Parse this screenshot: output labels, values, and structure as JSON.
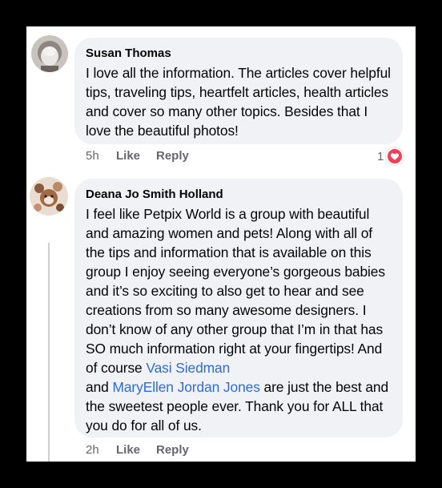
{
  "comments": [
    {
      "author": "Susan Thomas",
      "text": "I love all the information.  The articles cover helpful tips, traveling tips, heartfelt articles, health articles and cover so many other topics. Besides that I love the beautiful photos!",
      "time": "5h",
      "like_label": "Like",
      "reply_label": "Reply",
      "reaction_count": "1",
      "reaction_icon": "heart-icon"
    },
    {
      "author": "Deana Jo Smith Holland",
      "text_before": "I feel like Petpix World is a group with beautiful and amazing women and pets! Along with all of the tips and information that is available on this group I enjoy seeing everyone’s gorgeous babies and it’s so exciting to also get to hear and see creations from so many awesome designers. I don’t know of any other group that I’m in that has SO much information right at your fingertips! And of course ",
      "mention1": "Vasi Siedman",
      "text_between": "\nand ",
      "mention2": "MaryEllen Jordan Jones",
      "text_after": " are just the best and the sweetest people ever. Thank you for ALL that you do for all of us.",
      "time": "2h",
      "like_label": "Like",
      "reply_label": "Reply"
    }
  ],
  "colors": {
    "bubble": "#f0f2f5",
    "link": "#2f6bd8",
    "meta": "#65676b",
    "heart": "#f33e58"
  }
}
